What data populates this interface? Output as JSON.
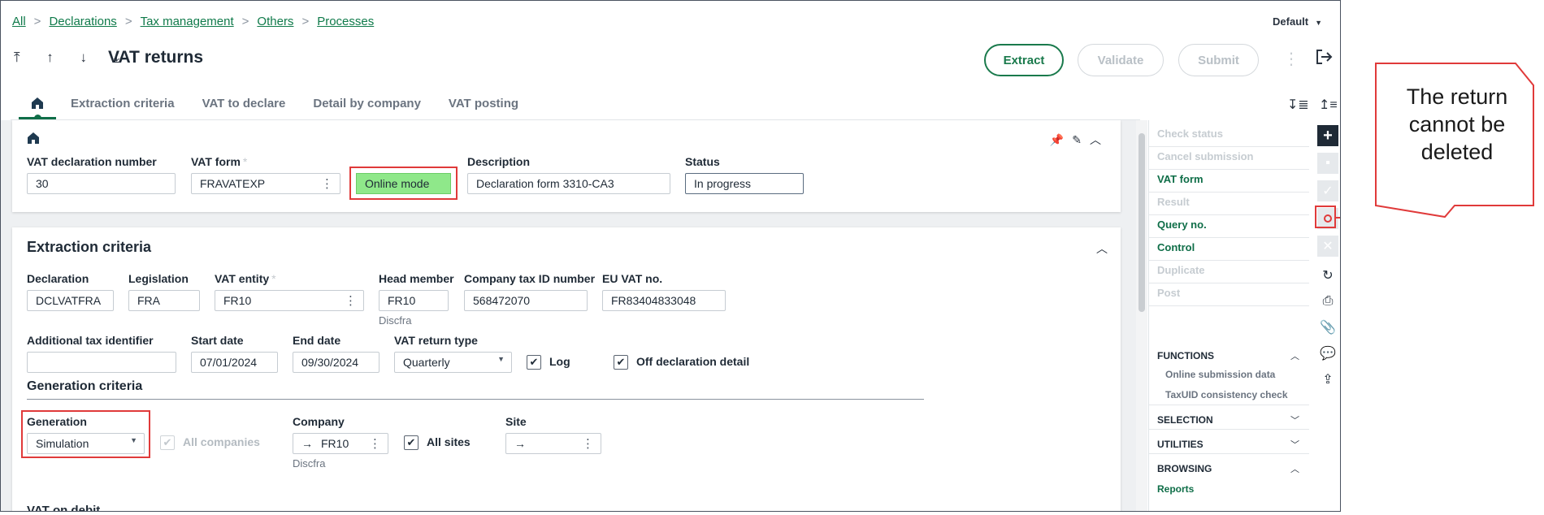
{
  "breadcrumb": [
    "All",
    "Declarations",
    "Tax management",
    "Others",
    "Processes"
  ],
  "header": {
    "default_label": "Default",
    "title": "VAT returns",
    "nav_arrows": "⤒ ↑ ↓ ⤓",
    "buttons": {
      "extract": "Extract",
      "validate": "Validate",
      "submit": "Submit"
    }
  },
  "tabs": [
    "Extraction criteria",
    "VAT to declare",
    "Detail by company",
    "VAT posting"
  ],
  "header_card": {
    "decl_number_label": "VAT declaration number",
    "decl_number": "30",
    "vat_form_label": "VAT form",
    "vat_form": "FRAVATEXP",
    "online_mode": "Online mode",
    "description_label": "Description",
    "description": "Declaration form 3310-CA3",
    "status_label": "Status",
    "status": "In progress"
  },
  "extraction": {
    "title": "Extraction criteria",
    "declaration_label": "Declaration",
    "declaration": "DCLVATFRA",
    "legislation_label": "Legislation",
    "legislation": "FRA",
    "vat_entity_label": "VAT entity",
    "vat_entity": "FR10",
    "head_member_label": "Head member",
    "head_member": "FR10",
    "head_member_sub": "Discfra",
    "company_tax_label": "Company tax ID number",
    "company_tax": "568472070",
    "eu_vat_label": "EU VAT no.",
    "eu_vat": "FR83404833048",
    "add_tax_label": "Additional tax identifier",
    "add_tax": "",
    "start_label": "Start date",
    "start": "07/01/2024",
    "end_label": "End date",
    "end": "09/30/2024",
    "return_type_label": "VAT return type",
    "return_type": "Quarterly",
    "log_label": "Log",
    "off_decl_label": "Off declaration detail",
    "gen_criteria": "Generation criteria",
    "generation_label": "Generation",
    "generation": "Simulation",
    "all_companies_label": "All companies",
    "company_label": "Company",
    "company": "FR10",
    "company_sub": "Discfra",
    "all_sites_label": "All sites",
    "site_label": "Site",
    "next_section": "VAT on debit"
  },
  "right_panel": {
    "items": [
      {
        "label": "Check status",
        "enabled": false
      },
      {
        "label": "Cancel submission",
        "enabled": false
      },
      {
        "label": "VAT form",
        "enabled": true
      },
      {
        "label": "Result",
        "enabled": false
      },
      {
        "label": "Query no.",
        "enabled": true
      },
      {
        "label": "Control",
        "enabled": true
      },
      {
        "label": "Duplicate",
        "enabled": false
      },
      {
        "label": "Post",
        "enabled": false
      }
    ],
    "functions": "FUNCTIONS",
    "functions_items": [
      "Online submission data",
      "TaxUID consistency check"
    ],
    "selection": "SELECTION",
    "utilities": "UTILITIES",
    "browsing": "BROWSING",
    "browsing_items": [
      "Reports"
    ]
  },
  "callout": {
    "text": "The return cannot be deleted"
  },
  "colors": {
    "accent": "#0f6e48",
    "highlight": "#e03a3a",
    "online": "#8fe88a"
  }
}
